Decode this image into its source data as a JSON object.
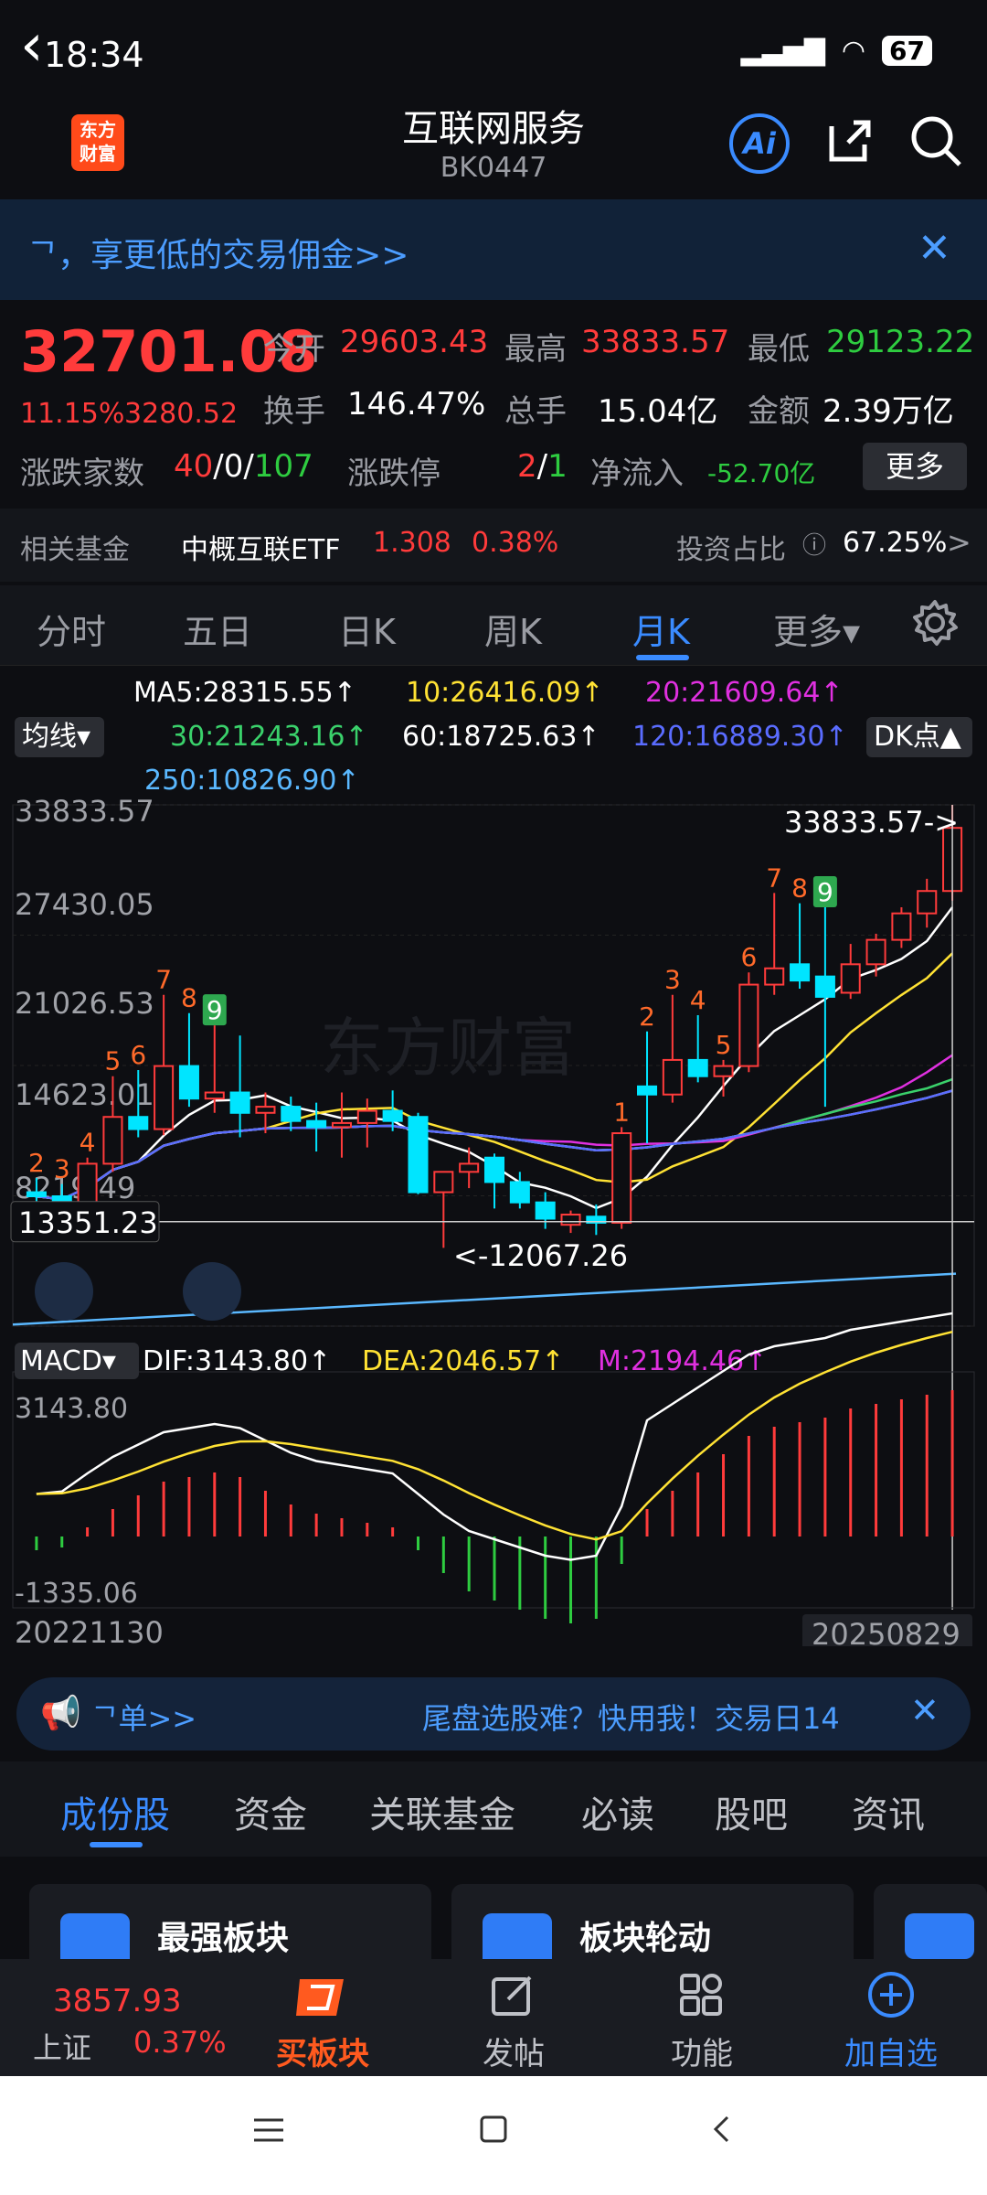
{
  "status": {
    "time": "18:34",
    "battery": "67"
  },
  "header": {
    "title": "互联网服务",
    "code": "BK0447",
    "logo": "东方\n财富",
    "ai_label": "Ai"
  },
  "banner": {
    "text": "ᄀ，享更低的交易佣金>>",
    "close": "✕"
  },
  "quote": {
    "price": "32701.08",
    "pct": "11.15%",
    "change": "3280.52",
    "open_label": "今开",
    "open": "29603.43",
    "high_label": "最高",
    "high": "33833.57",
    "low_label": "最低",
    "low": "29123.22",
    "turnover_label": "换手",
    "turnover": "146.47%",
    "volume_label": "总手",
    "volume": "15.04亿",
    "amount_label": "金额",
    "amount": "2.39万亿",
    "updown_label": "涨跌家数",
    "up": "40",
    "flat": "0",
    "down": "107",
    "limit_label": "涨跌停",
    "limit_up": "2",
    "limit_down": "1",
    "inflow_label": "净流入",
    "inflow": "-52.70亿",
    "more": "更多"
  },
  "fund": {
    "label": "相关基金",
    "name": "中概互联ETF",
    "price": "1.308",
    "pct": "0.38%",
    "ratio_label": "投资占比",
    "ratio": "67.25%",
    "arrow": ">"
  },
  "tabs": [
    "分时",
    "五日",
    "日K",
    "周K",
    "月K",
    "更多▾"
  ],
  "active_tab": "月K",
  "ma": {
    "button": "均线▾",
    "ma5": "MA5:28315.55↑",
    "ma10": "10:26416.09↑",
    "ma20": "20:21609.64↑",
    "ma30": "30:21243.16↑",
    "ma60": "60:18725.63↑",
    "ma120": "120:16889.30↑",
    "ma250": "250:10826.90↑",
    "dk": "DK点▲"
  },
  "chart_data": {
    "type": "candlestick",
    "y_labels": [
      "33833.57",
      "27430.05",
      "21026.53",
      "14623.01",
      "8219.49"
    ],
    "crosshair_value": "13351.23",
    "max_annotation": "33833.57->",
    "min_annotation": "<-12067.26",
    "x_start": "20221130",
    "x_end": "20250829",
    "macd_label": "MACD▾",
    "dif": "DIF:3143.80↑",
    "dea": "DEA:2046.57↑",
    "m": "M:2194.46↑",
    "macd_top": "3143.80",
    "macd_bottom": "-1335.06",
    "candles": [
      {
        "o": 14800,
        "h": 15500,
        "l": 14000,
        "c": 14600
      },
      {
        "o": 14600,
        "h": 15200,
        "l": 13900,
        "c": 14300
      },
      {
        "o": 14200,
        "h": 16500,
        "l": 14000,
        "c": 16200
      },
      {
        "o": 16200,
        "h": 20500,
        "l": 15800,
        "c": 18500
      },
      {
        "o": 18500,
        "h": 20800,
        "l": 17500,
        "c": 17900
      },
      {
        "o": 17900,
        "h": 24500,
        "l": 17600,
        "c": 21000
      },
      {
        "o": 21000,
        "h": 23600,
        "l": 19000,
        "c": 19400
      },
      {
        "o": 19400,
        "h": 23000,
        "l": 18700,
        "c": 19700
      },
      {
        "o": 19700,
        "h": 22500,
        "l": 17500,
        "c": 18700
      },
      {
        "o": 18700,
        "h": 19700,
        "l": 17700,
        "c": 19000
      },
      {
        "o": 19000,
        "h": 19500,
        "l": 17800,
        "c": 18300
      },
      {
        "o": 18300,
        "h": 19200,
        "l": 16800,
        "c": 18000
      },
      {
        "o": 18000,
        "h": 19700,
        "l": 16500,
        "c": 18200
      },
      {
        "o": 18200,
        "h": 19400,
        "l": 17000,
        "c": 18800
      },
      {
        "o": 18800,
        "h": 19800,
        "l": 17800,
        "c": 18300
      },
      {
        "o": 18500,
        "h": 18700,
        "l": 14700,
        "c": 14800
      },
      {
        "o": 14800,
        "h": 15700,
        "l": 12067,
        "c": 15800
      },
      {
        "o": 15800,
        "h": 17000,
        "l": 15000,
        "c": 16200
      },
      {
        "o": 16500,
        "h": 16700,
        "l": 14000,
        "c": 15300
      },
      {
        "o": 15300,
        "h": 15800,
        "l": 14000,
        "c": 14300
      },
      {
        "o": 14300,
        "h": 14800,
        "l": 13000,
        "c": 13500
      },
      {
        "o": 13200,
        "h": 13900,
        "l": 12800,
        "c": 13700
      },
      {
        "o": 13600,
        "h": 14200,
        "l": 12700,
        "c": 13300
      },
      {
        "o": 13300,
        "h": 18000,
        "l": 13000,
        "c": 17700
      },
      {
        "o": 20000,
        "h": 22700,
        "l": 17200,
        "c": 19600
      },
      {
        "o": 19600,
        "h": 24500,
        "l": 19200,
        "c": 21300
      },
      {
        "o": 21300,
        "h": 23500,
        "l": 20200,
        "c": 20500
      },
      {
        "o": 20500,
        "h": 21300,
        "l": 19500,
        "c": 21000
      },
      {
        "o": 21000,
        "h": 25600,
        "l": 20700,
        "c": 25000
      },
      {
        "o": 25000,
        "h": 29500,
        "l": 24500,
        "c": 25800
      },
      {
        "o": 26000,
        "h": 29000,
        "l": 24800,
        "c": 25200
      },
      {
        "o": 25400,
        "h": 28800,
        "l": 19000,
        "c": 24400
      },
      {
        "o": 24600,
        "h": 27000,
        "l": 24300,
        "c": 26000
      },
      {
        "o": 26000,
        "h": 27500,
        "l": 25400,
        "c": 27200
      },
      {
        "o": 27200,
        "h": 28800,
        "l": 26800,
        "c": 28500
      },
      {
        "o": 28500,
        "h": 30200,
        "l": 27800,
        "c": 29600
      },
      {
        "o": 29600,
        "h": 33833,
        "l": 29123,
        "c": 32701
      }
    ],
    "candle_labels": [
      {
        "i": 0,
        "t": "2",
        "c": "red"
      },
      {
        "i": 1,
        "t": "3",
        "c": "red"
      },
      {
        "i": 2,
        "t": "4",
        "c": "red"
      },
      {
        "i": 3,
        "t": "5",
        "c": "red"
      },
      {
        "i": 4,
        "t": "6",
        "c": "red"
      },
      {
        "i": 5,
        "t": "7",
        "c": "red"
      },
      {
        "i": 6,
        "t": "8",
        "c": "red"
      },
      {
        "i": 7,
        "t": "9",
        "c": "green"
      },
      {
        "i": 23,
        "t": "1",
        "c": "red"
      },
      {
        "i": 24,
        "t": "2",
        "c": "red"
      },
      {
        "i": 25,
        "t": "3",
        "c": "red"
      },
      {
        "i": 26,
        "t": "4",
        "c": "red"
      },
      {
        "i": 27,
        "t": "5",
        "c": "red"
      },
      {
        "i": 28,
        "t": "6",
        "c": "red"
      },
      {
        "i": 29,
        "t": "7",
        "c": "red"
      },
      {
        "i": 30,
        "t": "8",
        "c": "red"
      },
      {
        "i": 31,
        "t": "9",
        "c": "green"
      }
    ],
    "macd_hist": [
      -150,
      -120,
      100,
      300,
      450,
      600,
      650,
      700,
      650,
      500,
      350,
      250,
      200,
      150,
      100,
      -150,
      -400,
      -600,
      -700,
      -800,
      -900,
      -950,
      -900,
      -300,
      300,
      500,
      700,
      900,
      1100,
      1200,
      1250,
      1300,
      1400,
      1450,
      1500,
      1550,
      1600
    ]
  },
  "ad": {
    "text1": "ᄀ单>>",
    "text2": "尾盘选股难？快用我！交易日14",
    "close": "✕"
  },
  "bottom_tabs": [
    "成份股",
    "资金",
    "关联基金",
    "必读",
    "股吧",
    "资讯"
  ],
  "cards": [
    {
      "title": "最强板块"
    },
    {
      "title": "板块轮动"
    }
  ],
  "bnav": {
    "index_price": "3857.93",
    "index_name": "上证",
    "index_pct": "0.37%",
    "buy": "买板块",
    "post": "发帖",
    "func": "功能",
    "add": "加自选"
  },
  "colors": {
    "up": "#ff3b3b",
    "down": "#00e5ff",
    "accent": "#3a8bff",
    "bg": "#0d0e12"
  }
}
